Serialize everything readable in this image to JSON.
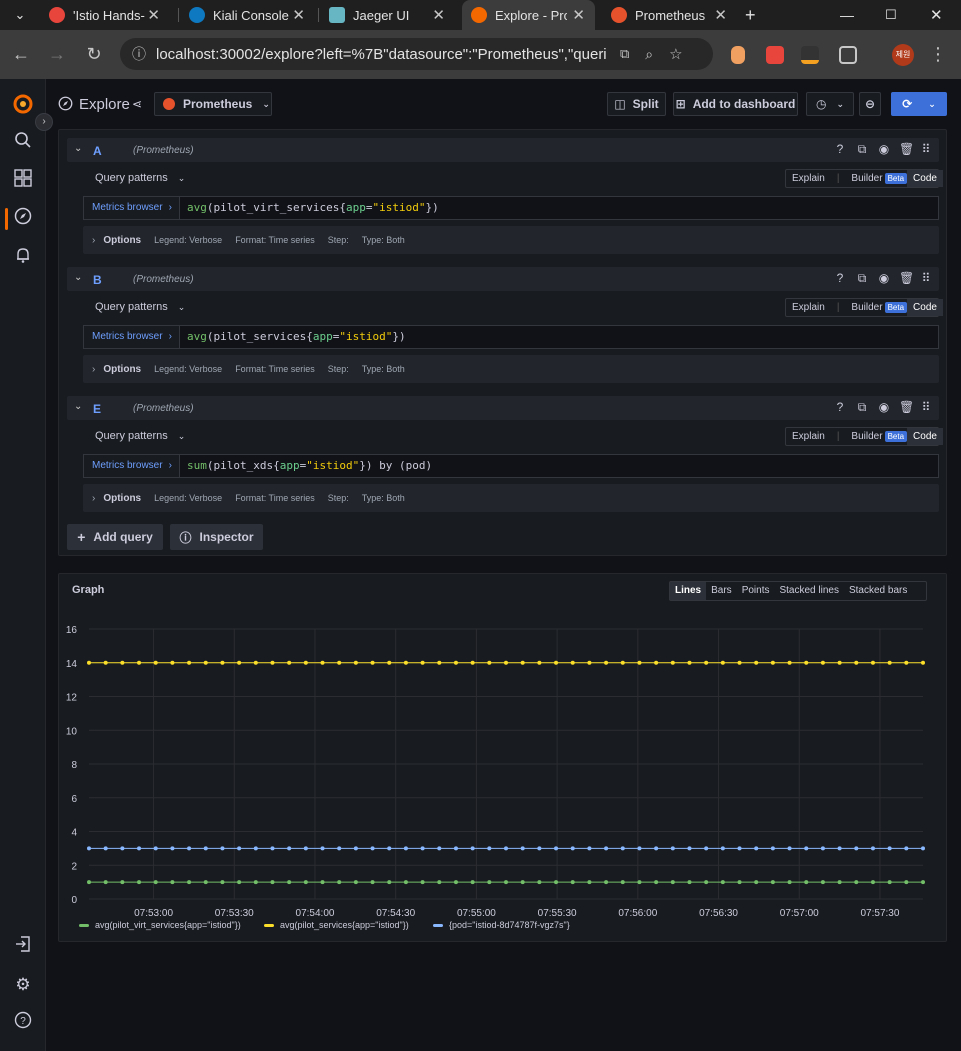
{
  "browser": {
    "tabs": [
      {
        "title": "'Istio Hands-",
        "color": "#e8453c"
      },
      {
        "title": "Kiali Console",
        "color": "#0e79c0"
      },
      {
        "title": "Jaeger UI",
        "color": "#67b6c4"
      },
      {
        "title": "Explore - Pro",
        "color": "#f46800"
      },
      {
        "title": "Prometheus",
        "color": "#e6522c"
      }
    ],
    "url": "localhost:30002/explore?left=%7B\"datasource\":\"Prometheus\",\"querie...",
    "profile": "제원"
  },
  "toolbar": {
    "title": "Explore",
    "datasource": "Prometheus",
    "split_label": "Split",
    "add_dashboard_label": "Add to dashboard"
  },
  "queries": [
    {
      "ref": "A",
      "ds": "(Prometheus)",
      "patterns": "Query patterns",
      "explain": "Explain",
      "builder": "Builder",
      "beta": "Beta",
      "code": "Code",
      "metrics_browser": "Metrics browser",
      "fn": "avg",
      "metric": "pilot_virt_services",
      "label_key": "app",
      "label_val": "\"istiod\"",
      "suffix": "",
      "options": "Options",
      "legend": "Legend: Verbose",
      "format": "Format: Time series",
      "step": "Step:",
      "type": "Type: Both"
    },
    {
      "ref": "B",
      "ds": "(Prometheus)",
      "patterns": "Query patterns",
      "explain": "Explain",
      "builder": "Builder",
      "beta": "Beta",
      "code": "Code",
      "metrics_browser": "Metrics browser",
      "fn": "avg",
      "metric": "pilot_services",
      "label_key": "app",
      "label_val": "\"istiod\"",
      "suffix": "",
      "options": "Options",
      "legend": "Legend: Verbose",
      "format": "Format: Time series",
      "step": "Step:",
      "type": "Type: Both"
    },
    {
      "ref": "E",
      "ds": "(Prometheus)",
      "patterns": "Query patterns",
      "explain": "Explain",
      "builder": "Builder",
      "beta": "Beta",
      "code": "Code",
      "metrics_browser": "Metrics browser",
      "fn": "sum",
      "metric": "pilot_xds",
      "label_key": "app",
      "label_val": "\"istiod\"",
      "suffix": " by (pod)",
      "options": "Options",
      "legend": "Legend: Verbose",
      "format": "Format: Time series",
      "step": "Step:",
      "type": "Type: Both"
    }
  ],
  "actions": {
    "add_query": "Add query",
    "inspector": "Inspector"
  },
  "graph": {
    "title": "Graph",
    "modes": [
      "Lines",
      "Bars",
      "Points",
      "Stacked lines",
      "Stacked bars"
    ],
    "active_mode": "Lines"
  },
  "chart_data": {
    "type": "line",
    "title": "Graph",
    "ylim": [
      0,
      16
    ],
    "yticks": [
      0,
      2,
      4,
      6,
      8,
      10,
      12,
      14,
      16
    ],
    "xticks": [
      "07:53:00",
      "07:53:30",
      "07:54:00",
      "07:54:30",
      "07:55:00",
      "07:55:30",
      "07:56:00",
      "07:56:30",
      "07:57:00",
      "07:57:30"
    ],
    "x_start": "07:52:36",
    "x_end": "07:57:46",
    "points": 51,
    "grid": true,
    "legend_position": "bottom-left",
    "series": [
      {
        "name": "avg(pilot_virt_services{app=\"istiod\"})",
        "color": "#73bf69",
        "value": 1
      },
      {
        "name": "avg(pilot_services{app=\"istiod\"})",
        "color": "#fade2a",
        "value": 14
      },
      {
        "name": "{pod=\"istiod-8d74787f-vgz7s\"}",
        "color": "#8ab8ff",
        "value": 3
      }
    ]
  }
}
